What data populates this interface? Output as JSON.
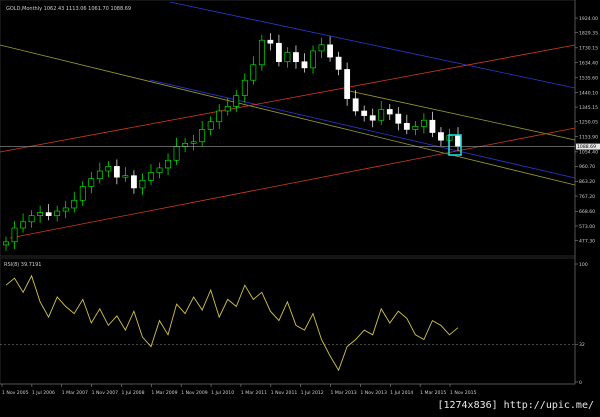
{
  "main_chart": {
    "header": "GOLD,Monthly  1062.43 1113.06 1061.70 1088.69",
    "price_badge": "1088.69",
    "y_ticks": [
      "1924.00",
      "1829.35",
      "1730.15",
      "1634.40",
      "1535.60",
      "1440.10",
      "1345.15",
      "1250.05",
      "1153.90",
      "1054.40",
      "960.70",
      "863.20",
      "767.20",
      "668.60",
      "573.00",
      "477.30"
    ],
    "y_min": 430,
    "y_max": 1950,
    "current_price": 1088.69
  },
  "rsi_panel": {
    "header": "RSI(8) 39.7191",
    "y_ticks": [
      "100",
      "32",
      "0"
    ],
    "level": 32
  },
  "x_axis": {
    "labels": [
      "1 Nov 2005",
      "1 Jul 2006",
      "1 Mar 2007",
      "1 Nov 2007",
      "1 Jul 2008",
      "1 Mar 2009",
      "1 Nov 2009",
      "1 Jul 2010",
      "1 Mar 2011",
      "1 Nov 2011",
      "1 Jul 2012",
      "1 Mar 2013",
      "1 Nov 2013",
      "1 Jul 2014",
      "1 Mar 2015",
      "1 Nov 2015"
    ]
  },
  "colors": {
    "up_candle": "#00ff00",
    "down_candle": "#ffffff",
    "rsi_line": "#d4c44a",
    "blue_line": "#2a3ad8",
    "red_line": "#d23a1e",
    "yellow_line": "#9c9c30",
    "highlight_box": "#19d7d7"
  },
  "chart_data": {
    "type": "candlestick",
    "title": "GOLD,Monthly",
    "interval": "Monthly",
    "x_range": [
      "2005-11",
      "2015-11"
    ],
    "price_series": {
      "name": "GOLD",
      "step_months": 3,
      "close": [
        470,
        560,
        600,
        640,
        660,
        640,
        670,
        690,
        740,
        830,
        880,
        930,
        960,
        890,
        900,
        820,
        870,
        920,
        950,
        1000,
        1090,
        1110,
        1120,
        1200,
        1250,
        1320,
        1350,
        1420,
        1520,
        1620,
        1780,
        1760,
        1640,
        1700,
        1640,
        1600,
        1710,
        1750,
        1670,
        1590,
        1400,
        1320,
        1290,
        1260,
        1330,
        1300,
        1240,
        1200,
        1220,
        1260,
        1180,
        1130,
        1160,
        1090
      ]
    },
    "rsi": {
      "name": "RSI(8)",
      "last": 39.7191,
      "level": 32,
      "values": [
        82,
        88,
        76,
        90,
        68,
        55,
        72,
        64,
        58,
        70,
        50,
        62,
        48,
        56,
        44,
        60,
        38,
        30,
        52,
        40,
        66,
        58,
        72,
        61,
        78,
        55,
        70,
        64,
        82,
        70,
        76,
        60,
        52,
        68,
        48,
        44,
        58,
        36,
        22,
        10,
        30,
        36,
        44,
        40,
        62,
        50,
        60,
        54,
        40,
        36,
        52,
        48,
        40,
        46
      ]
    },
    "x_labels": [
      "1 Nov 2005",
      "1 Jul 2006",
      "1 Mar 2007",
      "1 Nov 2007",
      "1 Jul 2008",
      "1 Mar 2009",
      "1 Nov 2009",
      "1 Jul 2010",
      "1 Mar 2011",
      "1 Nov 2011",
      "1 Jul 2012",
      "1 Mar 2013",
      "1 Nov 2013",
      "1 Jul 2014",
      "1 Mar 2015",
      "1 Nov 2015"
    ],
    "y_ticks_price": [
      1924.0,
      1829.35,
      1730.15,
      1634.4,
      1535.6,
      1440.1,
      1345.15,
      1250.05,
      1153.9,
      1054.4,
      960.7,
      863.2,
      767.2,
      668.6,
      573.0,
      477.3
    ],
    "y_ticks_rsi": [
      100,
      32,
      0
    ]
  },
  "watermark": "[1274x836] http://upic.me/"
}
